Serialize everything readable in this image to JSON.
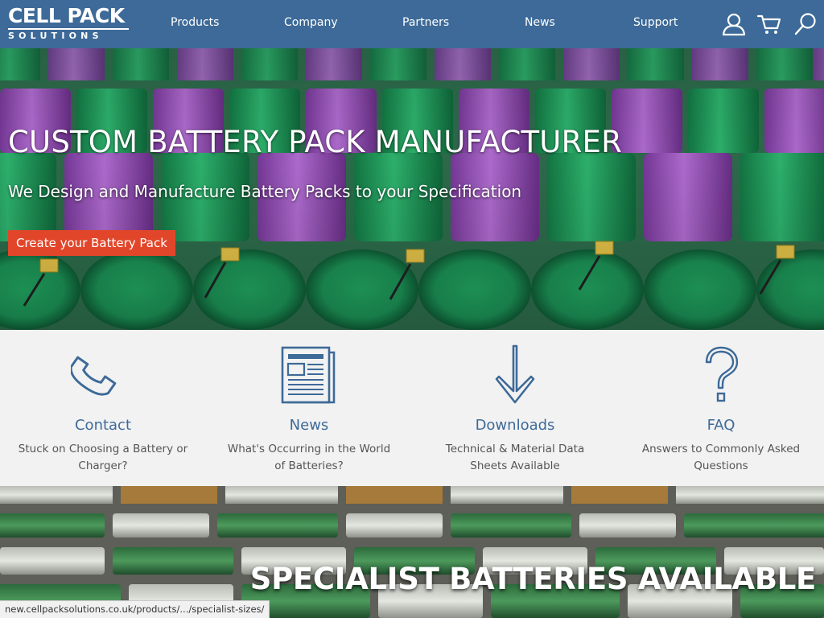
{
  "header": {
    "logo_top": "CELL PACK",
    "logo_bottom": "SOLUTIONS",
    "nav": [
      "Products",
      "Company",
      "Partners",
      "News",
      "Support"
    ],
    "icons": [
      "user-icon",
      "cart-icon",
      "search-icon"
    ],
    "background": "#3d6a98"
  },
  "hero": {
    "title": "CUSTOM BATTERY PACK MANUFACTURER",
    "subtitle": "We Design and Manufacture Battery Packs to your Specification",
    "button_label": "Create your Battery Pack",
    "button_color": "#e2462a"
  },
  "features": [
    {
      "icon": "phone-icon",
      "title": "Contact",
      "text": "Stuck on Choosing a Battery or Charger?"
    },
    {
      "icon": "newspaper-icon",
      "title": "News",
      "text": "What's Occurring in the World of Batteries?"
    },
    {
      "icon": "download-arrow-icon",
      "title": "Downloads",
      "text": "Technical & Material Data Sheets Available"
    },
    {
      "icon": "question-mark-icon",
      "title": "FAQ",
      "text": "Answers to Commonly Asked Questions"
    }
  ],
  "banner": {
    "title": "SPECIALIST BATTERIES AVAILABLE"
  },
  "statusbar": {
    "url": "new.cellpacksolutions.co.uk/products/.../specialist-sizes/"
  },
  "colors": {
    "accent_blue": "#3d6a98",
    "cta_red": "#e2462a",
    "feature_bg": "#f2f2f2"
  }
}
